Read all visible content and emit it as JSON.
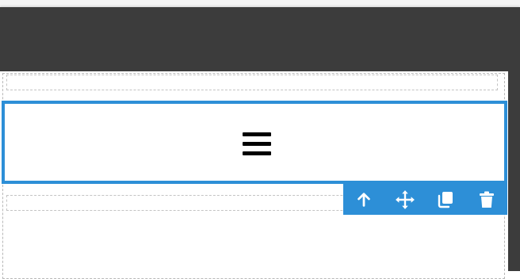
{
  "editor": {
    "colors": {
      "topbar": "#3c3c3c",
      "selection_accent": "#2d8fd7",
      "dashed_outline": "#b8b8b8",
      "canvas": "#ffffff"
    },
    "selected_component": {
      "icon": "hamburger-menu-icon"
    },
    "toolbar": {
      "actions": [
        {
          "icon": "arrow-up-icon",
          "action": "select-parent"
        },
        {
          "icon": "move-icon",
          "action": "move"
        },
        {
          "icon": "copy-icon",
          "action": "clone"
        },
        {
          "icon": "trash-icon",
          "action": "delete"
        }
      ]
    }
  }
}
